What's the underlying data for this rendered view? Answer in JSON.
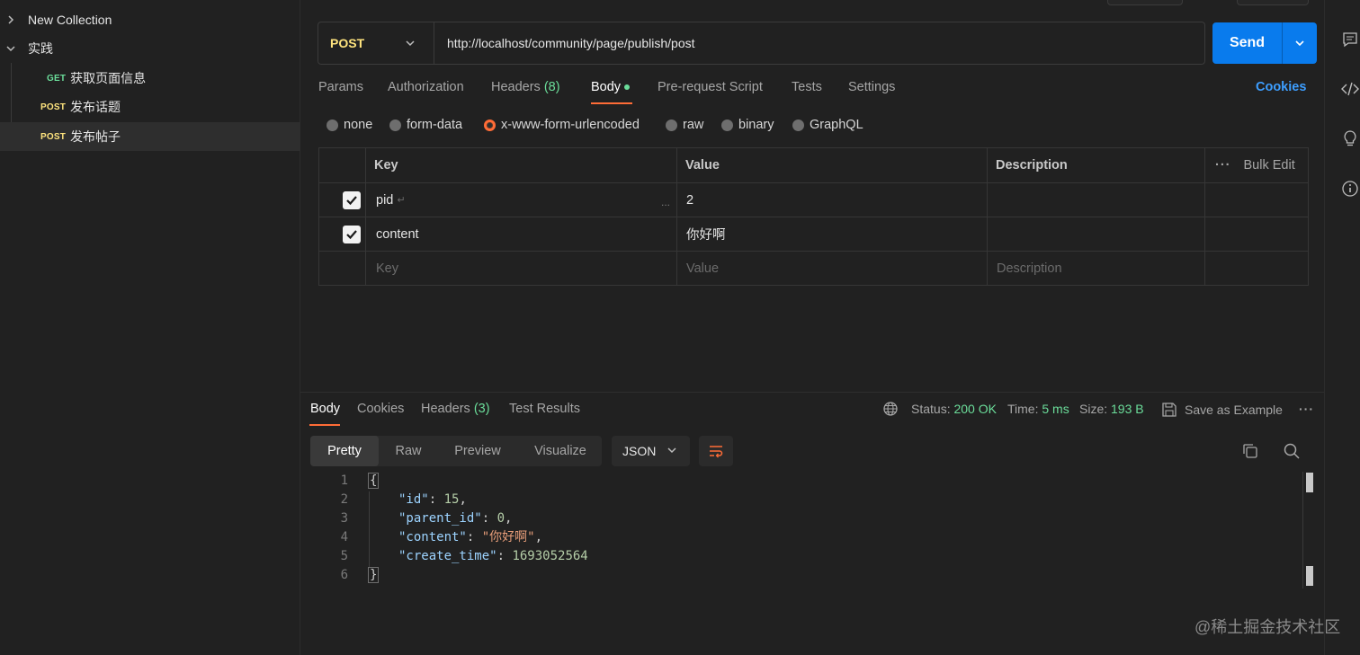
{
  "sidebar": {
    "collection": "New Collection",
    "folder": "实践",
    "items": [
      {
        "method": "GET",
        "name": "获取页面信息"
      },
      {
        "method": "POST",
        "name": "发布话题"
      },
      {
        "method": "POST",
        "name": "发布帖子"
      }
    ]
  },
  "request": {
    "method": "POST",
    "url": "http://localhost/community/page/publish/post",
    "send_label": "Send"
  },
  "tabs": {
    "params": "Params",
    "authorization": "Authorization",
    "headers": "Headers",
    "headers_count": "(8)",
    "body": "Body",
    "prerequest": "Pre-request Script",
    "tests": "Tests",
    "settings": "Settings",
    "cookies": "Cookies"
  },
  "body_types": {
    "none": "none",
    "form_data": "form-data",
    "urlencoded": "x-www-form-urlencoded",
    "raw": "raw",
    "binary": "binary",
    "graphql": "GraphQL",
    "selected": "x-www-form-urlencoded"
  },
  "table": {
    "headers": {
      "key": "Key",
      "value": "Value",
      "description": "Description",
      "bulk_edit": "Bulk Edit"
    },
    "rows": [
      {
        "key": "pid",
        "value": "2",
        "checked": true
      },
      {
        "key": "content",
        "value": "你好啊",
        "checked": true
      }
    ],
    "placeholders": {
      "key": "Key",
      "value": "Value",
      "description": "Description"
    }
  },
  "response": {
    "tabs": {
      "body": "Body",
      "cookies": "Cookies",
      "headers": "Headers",
      "headers_count": "(3)",
      "test_results": "Test Results"
    },
    "status_label": "Status:",
    "status": "200 OK",
    "time_label": "Time:",
    "time": "5 ms",
    "size_label": "Size:",
    "size": "193 B",
    "save_example": "Save as Example",
    "views": {
      "pretty": "Pretty",
      "raw": "Raw",
      "preview": "Preview",
      "visualize": "Visualize"
    },
    "format": "JSON",
    "code": {
      "line_numbers": [
        "1",
        "2",
        "3",
        "4",
        "5",
        "6"
      ],
      "open": "{",
      "close": "}",
      "fields": [
        {
          "key": "\"id\"",
          "value": "15",
          "type": "number"
        },
        {
          "key": "\"parent_id\"",
          "value": "0",
          "type": "number"
        },
        {
          "key": "\"content\"",
          "value": "\"你好啊\"",
          "type": "string"
        },
        {
          "key": "\"create_time\"",
          "value": "1693052564",
          "type": "number"
        }
      ]
    }
  },
  "watermark": "@稀土掘金技术社区",
  "colors": {
    "accent": "#ff6c37",
    "send": "#097bed",
    "post": "#ffe47e",
    "get": "#6bdd9a",
    "link": "#3d9eff"
  }
}
